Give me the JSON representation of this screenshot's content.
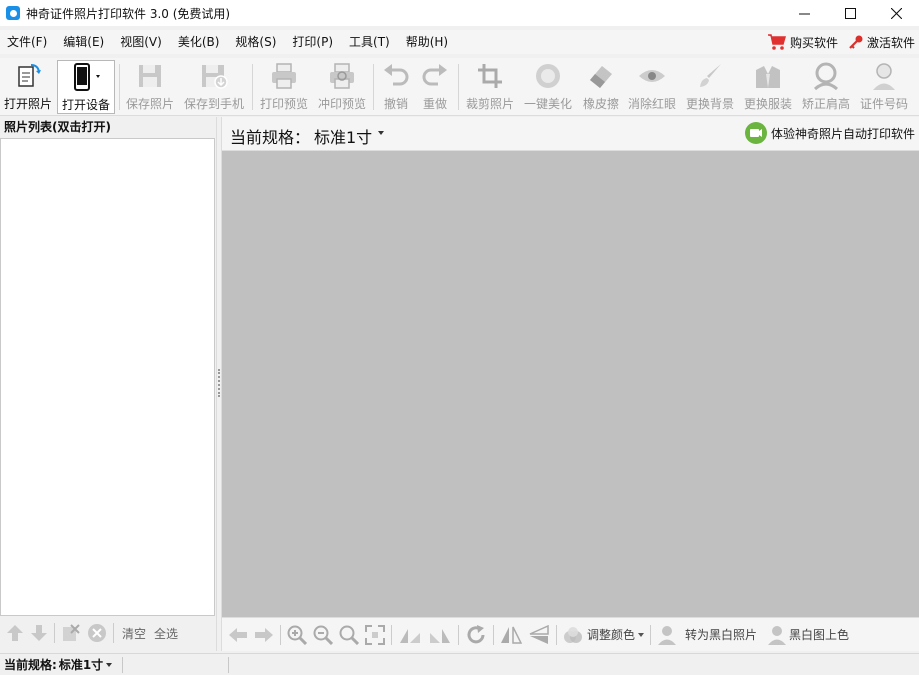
{
  "window": {
    "title": "神奇证件照片打印软件 3.0 (免费试用)",
    "minimize_glyph": "—",
    "maximize_glyph": "☐",
    "close_glyph": "✕"
  },
  "menu": {
    "items": [
      "文件(F)",
      "编辑(E)",
      "视图(V)",
      "美化(B)",
      "规格(S)",
      "打印(P)",
      "工具(T)",
      "帮助(H)"
    ],
    "buy": "购买软件",
    "activate": "激活软件"
  },
  "toolbar": {
    "open_photo": "打开照片",
    "open_device": "打开设备",
    "save_photo": "保存照片",
    "save_to_phone": "保存到手机",
    "print_preview": "打印预览",
    "develop_preview": "冲印预览",
    "undo": "撤销",
    "redo": "重做",
    "crop": "裁剪照片",
    "one_click_beautify": "一键美化",
    "eraser": "橡皮擦",
    "red_eye": "消除红眼",
    "change_background": "更换背景",
    "change_clothes": "更换服装",
    "fix_shoulder": "矫正肩高",
    "id_number": "证件号码"
  },
  "left_panel": {
    "title": "照片列表(双击打开)",
    "clear": "清空",
    "select_all": "全选"
  },
  "spec_bar": {
    "label": "当前规格：",
    "value": "标准1寸",
    "promo": "体验神奇照片自动打印软件"
  },
  "bottom_toolbar": {
    "adjust_color": "调整颜色",
    "to_black_white": "转为黑白照片",
    "bw_colorize": "黑白图上色"
  },
  "status": {
    "label": "当前规格:",
    "value": "标准1寸"
  },
  "colors": {
    "canvas": "#c0c0c0",
    "accent_blue": "#1a8fe8",
    "cart_red": "#e03030",
    "key_red": "#d9302c",
    "promo_green": "#6ab43f",
    "disabled_icon": "#b4b4b4"
  }
}
